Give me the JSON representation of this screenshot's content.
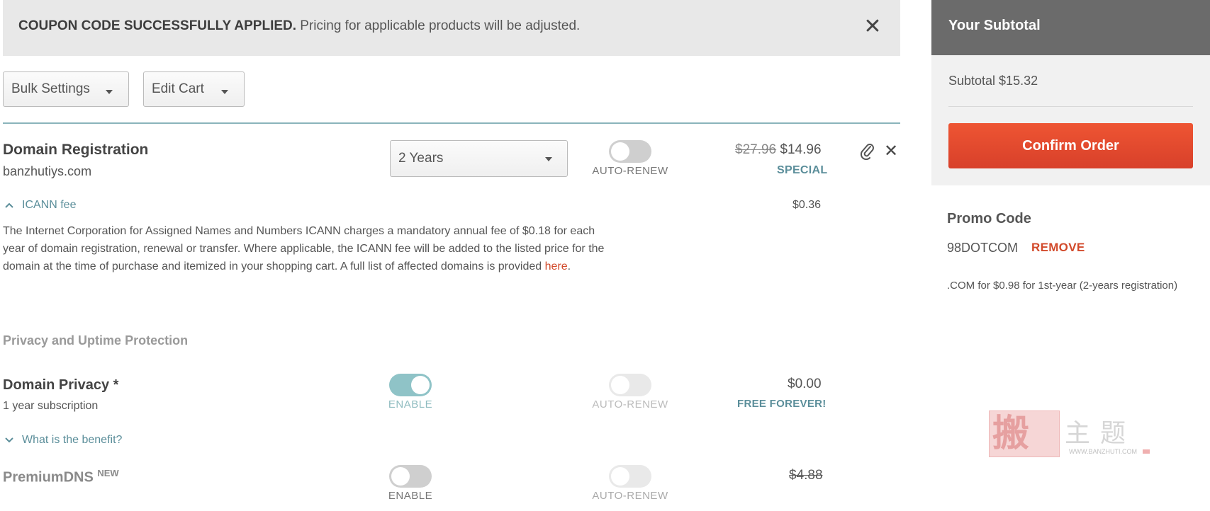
{
  "banner": {
    "bold": "COUPON CODE SUCCESSFULLY APPLIED.",
    "text": " Pricing for applicable products will be adjusted.",
    "close_icon": "close-icon"
  },
  "toolbar": {
    "bulk_settings": "Bulk Settings",
    "edit_cart": "Edit Cart"
  },
  "domain_registration": {
    "title": "Domain Registration",
    "domain": "banzhutiys.com",
    "term": "2 Years",
    "auto_renew_label": "AUTO-RENEW",
    "auto_renew_on": false,
    "old_price": "$27.96",
    "price": "$14.96",
    "tag": "SPECIAL"
  },
  "icann": {
    "label": "ICANN fee",
    "price": "$0.36",
    "para": "The Internet Corporation for Assigned Names and Numbers ICANN charges a mandatory annual fee of $0.18 for each year of domain registration, renewal or transfer. Where applicable, the ICANN fee will be added to the listed price for the domain at the time of purchase and itemized in your shopping cart. A full list of affected domains is provided ",
    "link": "here",
    "after_link": "."
  },
  "section_heading": "Privacy and Uptime Protection",
  "domain_privacy": {
    "title": "Domain Privacy *",
    "subtitle": "1 year subscription",
    "enable_label": "ENABLE",
    "enabled": true,
    "auto_renew_label": "AUTO-RENEW",
    "price": "$0.00",
    "tag": "FREE FOREVER!",
    "benefit_link": "What is the benefit?"
  },
  "premium_dns": {
    "title": "PremiumDNS",
    "badge": "NEW",
    "enable_label": "ENABLE",
    "enabled": false,
    "auto_renew_label": "AUTO-RENEW",
    "price": "$4.88"
  },
  "sidebar": {
    "heading": "Your Subtotal",
    "subtotal": "Subtotal $15.32",
    "confirm": "Confirm Order",
    "promo_title": "Promo Code",
    "promo_code": "98DOTCOM",
    "remove": "REMOVE",
    "promo_desc": ".COM for $0.98 for 1st-year (2-years registration)"
  },
  "watermark": {
    "seal": "搬",
    "text": "主题",
    "url": "WWW.BANZHUTI.COM"
  },
  "colors": {
    "accent_teal": "#8fc3c7",
    "confirm_red": "#e44a2f",
    "remove_red": "#d24a2b",
    "header_gray": "#6b6b6b"
  }
}
